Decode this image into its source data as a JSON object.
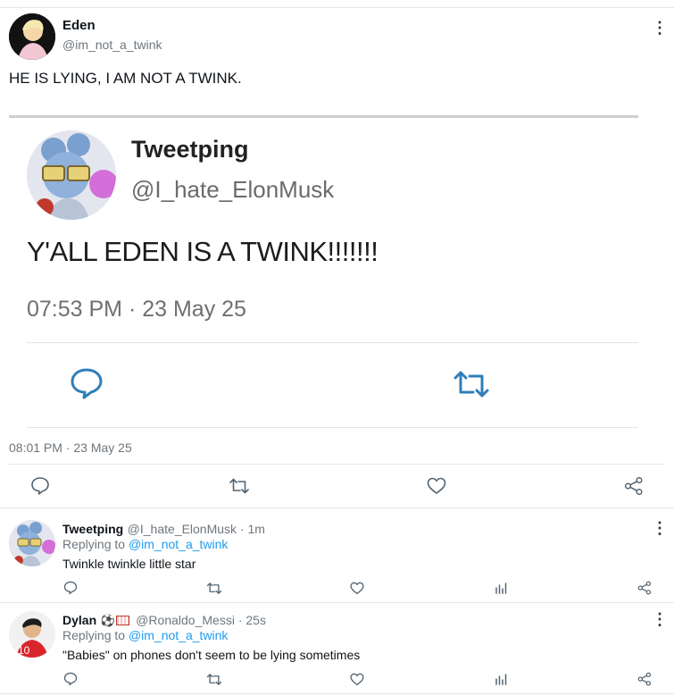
{
  "main_tweet": {
    "author": "Eden",
    "handle": "@im_not_a_twink",
    "text": "HE IS LYING, I AM NOT A TWINK.",
    "timestamp": "08:01 PM · 23 May 25"
  },
  "embedded_tweet": {
    "author": "Tweetping",
    "handle": "@I_hate_ElonMusk",
    "text": "Y'ALL EDEN IS A TWINK!!!!!!!",
    "timestamp": "07:53 PM · 23 May 25"
  },
  "replies": [
    {
      "author": "Tweetping",
      "meta": "@I_hate_ElonMusk · 1m",
      "replying_prefix": "Replying to ",
      "replying_handle": "@im_not_a_twink",
      "text": "Twinkle twinkle little star"
    },
    {
      "author": "Dylan",
      "meta": "@Ronaldo_Messi · 25s",
      "replying_prefix": "Replying to ",
      "replying_handle": "@im_not_a_twink",
      "text": "\"Babies\" on phones don't seem to be lying sometimes",
      "avatar_jersey_number": "10"
    }
  ],
  "icons": {
    "menu": "more-vert-icon",
    "reply": "comment-icon",
    "retweet": "retweet-icon",
    "like": "heart-icon",
    "share": "share-icon",
    "stats": "stats-icon"
  },
  "colors": {
    "link": "#1d9bf0",
    "muted": "#6e767d",
    "divider": "#e6e6e6"
  }
}
